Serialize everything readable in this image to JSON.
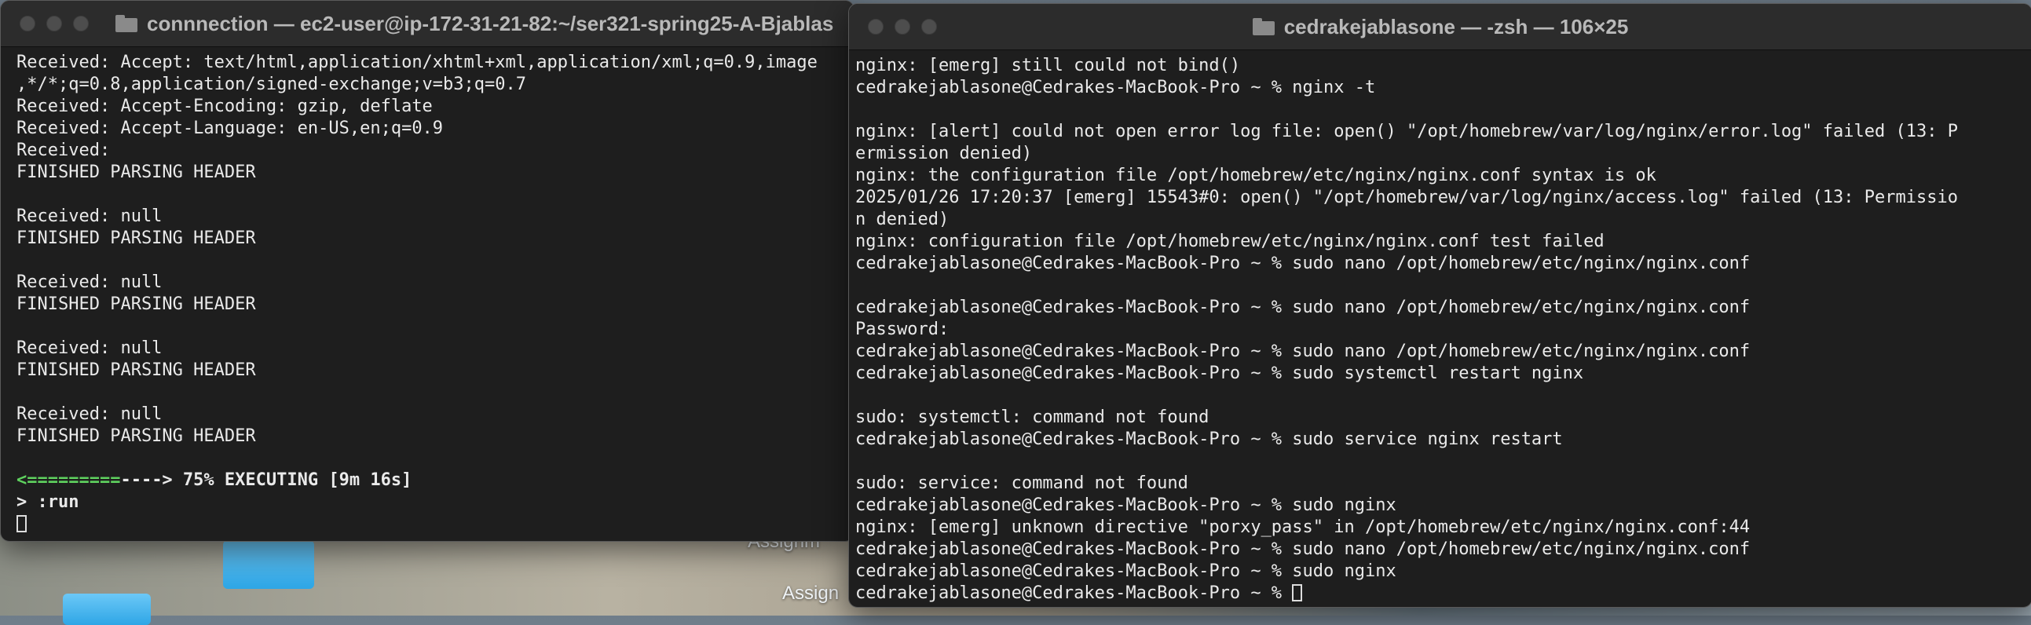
{
  "desktop": {
    "labels": [
      "Assignm",
      "Assign"
    ]
  },
  "left_window": {
    "title": "connnection — ec2-user@ip-172-31-21-82:~/ser321-spring25-A-Bjablas",
    "lines": [
      "Received: Accept: text/html,application/xhtml+xml,application/xml;q=0.9,image",
      ",*/*;q=0.8,application/signed-exchange;v=b3;q=0.7",
      "Received: Accept-Encoding: gzip, deflate",
      "Received: Accept-Language: en-US,en;q=0.9",
      "Received:",
      "FINISHED PARSING HEADER",
      "",
      "Received: null",
      "FINISHED PARSING HEADER",
      "",
      "Received: null",
      "FINISHED PARSING HEADER",
      "",
      "Received: null",
      "FINISHED PARSING HEADER",
      "",
      "Received: null",
      "FINISHED PARSING HEADER",
      ""
    ],
    "progress": {
      "bar_done": "<=========",
      "bar_rest": "----> 75% EXECUTING [9m 16s]",
      "percent": 75
    },
    "prompt_line": "> :run"
  },
  "right_window": {
    "title": "cedrakejablasone — -zsh — 106×25",
    "lines": [
      "nginx: [emerg] still could not bind()",
      "cedrakejablasone@Cedrakes-MacBook-Pro ~ % nginx -t",
      "",
      "nginx: [alert] could not open error log file: open() \"/opt/homebrew/var/log/nginx/error.log\" failed (13: P",
      "ermission denied)",
      "nginx: the configuration file /opt/homebrew/etc/nginx/nginx.conf syntax is ok",
      "2025/01/26 17:20:37 [emerg] 15543#0: open() \"/opt/homebrew/var/log/nginx/access.log\" failed (13: Permissio",
      "n denied)",
      "nginx: configuration file /opt/homebrew/etc/nginx/nginx.conf test failed",
      "cedrakejablasone@Cedrakes-MacBook-Pro ~ % sudo nano /opt/homebrew/etc/nginx/nginx.conf",
      "",
      "cedrakejablasone@Cedrakes-MacBook-Pro ~ % sudo nano /opt/homebrew/etc/nginx/nginx.conf",
      "Password:",
      "cedrakejablasone@Cedrakes-MacBook-Pro ~ % sudo nano /opt/homebrew/etc/nginx/nginx.conf",
      "cedrakejablasone@Cedrakes-MacBook-Pro ~ % sudo systemctl restart nginx",
      "",
      "sudo: systemctl: command not found",
      "cedrakejablasone@Cedrakes-MacBook-Pro ~ % sudo service nginx restart",
      "",
      "sudo: service: command not found",
      "cedrakejablasone@Cedrakes-MacBook-Pro ~ % sudo nginx",
      "nginx: [emerg] unknown directive \"porxy_pass\" in /opt/homebrew/etc/nginx/nginx.conf:44",
      "cedrakejablasone@Cedrakes-MacBook-Pro ~ % sudo nano /opt/homebrew/etc/nginx/nginx.conf",
      "cedrakejablasone@Cedrakes-MacBook-Pro ~ % sudo nginx"
    ],
    "prompt_line": "cedrakejablasone@Cedrakes-MacBook-Pro ~ % "
  },
  "colors": {
    "terminal_bg": "#1e1e1e",
    "terminal_fg": "#eaeaea",
    "progress_green": "#5fd35f",
    "titlebar_bg": "#2c2c2c"
  }
}
